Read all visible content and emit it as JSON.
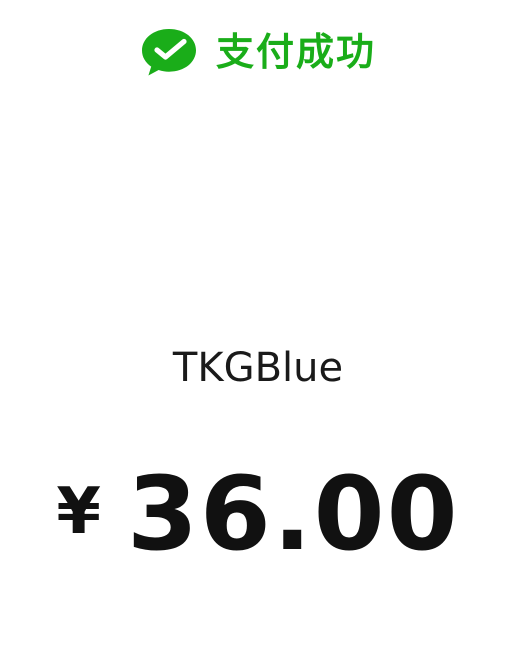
{
  "header": {
    "icon": "wechat-pay-icon",
    "status_text": "支付成功",
    "accent_color": "#1AAD19"
  },
  "payment": {
    "merchant": "TKGBlue",
    "currency_symbol": "¥",
    "amount": "36.00"
  }
}
